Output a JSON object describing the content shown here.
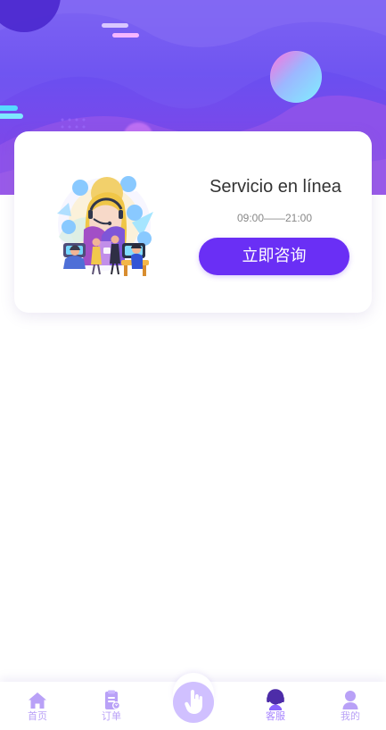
{
  "card": {
    "title": "Servicio en línea",
    "hours": "09:00——21:00",
    "button_label": "立即咨询"
  },
  "nav": {
    "items": [
      {
        "label": "首页",
        "icon": "home-icon"
      },
      {
        "label": "订单",
        "icon": "order-icon"
      },
      {
        "label": "",
        "icon": "tap-hand-icon"
      },
      {
        "label": "客服",
        "icon": "customer-service-icon"
      },
      {
        "label": "我的",
        "icon": "profile-icon"
      }
    ]
  },
  "colors": {
    "accent": "#6a2ff5",
    "nav_text": "#b9a1f7",
    "hero_purple": "#7b48ea",
    "card_bg": "#ffffff"
  }
}
